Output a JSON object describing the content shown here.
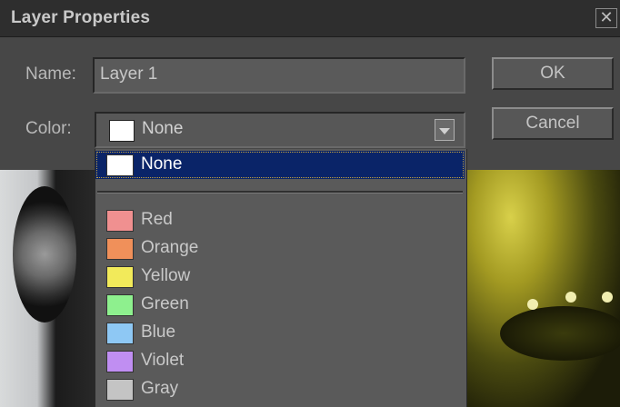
{
  "dialog": {
    "title": "Layer Properties",
    "close_glyph": "✕"
  },
  "form": {
    "name_label": "Name:",
    "name_value": "Layer 1",
    "color_label": "Color:",
    "color_selected": "None",
    "color_selected_swatch": "#ffffff"
  },
  "buttons": {
    "ok": "OK",
    "cancel": "Cancel"
  },
  "color_options": [
    {
      "label": "None",
      "swatch": "#ffffff",
      "selected": true
    },
    {
      "label": "Red",
      "swatch": "#f09090"
    },
    {
      "label": "Orange",
      "swatch": "#f0905a"
    },
    {
      "label": "Yellow",
      "swatch": "#f2ea5a"
    },
    {
      "label": "Green",
      "swatch": "#8ef08e"
    },
    {
      "label": "Blue",
      "swatch": "#8ec8f4"
    },
    {
      "label": "Violet",
      "swatch": "#c08ef2"
    },
    {
      "label": "Gray",
      "swatch": "#c4c4c4"
    }
  ]
}
